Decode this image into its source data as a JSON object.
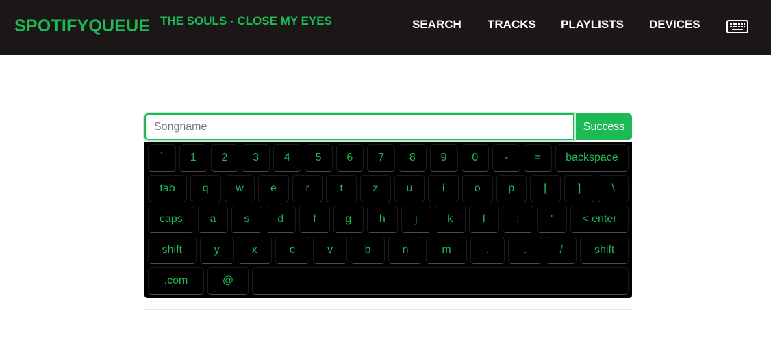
{
  "navbar": {
    "brand": "SPOTIFYQUEUE",
    "now_playing": "THE SOULS - CLOSE MY EYES",
    "links": [
      "SEARCH",
      "TRACKS",
      "PLAYLISTS",
      "DEVICES"
    ],
    "keyboard_icon": "keyboard-icon"
  },
  "search": {
    "placeholder": "Songname",
    "value": "",
    "button_label": "Success"
  },
  "keyboard": {
    "rows": [
      [
        "`",
        "1",
        "2",
        "3",
        "4",
        "5",
        "6",
        "7",
        "8",
        "9",
        "0",
        "-",
        "=",
        "backspace"
      ],
      [
        "tab",
        "q",
        "w",
        "e",
        "r",
        "t",
        "z",
        "u",
        "i",
        "o",
        "p",
        "[",
        "]",
        "\\"
      ],
      [
        "caps",
        "a",
        "s",
        "d",
        "f",
        "g",
        "h",
        "j",
        "k",
        "l",
        ";",
        "'",
        "< enter"
      ],
      [
        "shift",
        "y",
        "x",
        "c",
        "v",
        "b",
        "n",
        "m",
        ",",
        ".",
        "/",
        "shift"
      ],
      [
        ".com",
        "@",
        ""
      ]
    ]
  },
  "colors": {
    "accent": "#1db954",
    "navbar_bg": "#1a1716",
    "keyboard_bg": "#000000"
  }
}
